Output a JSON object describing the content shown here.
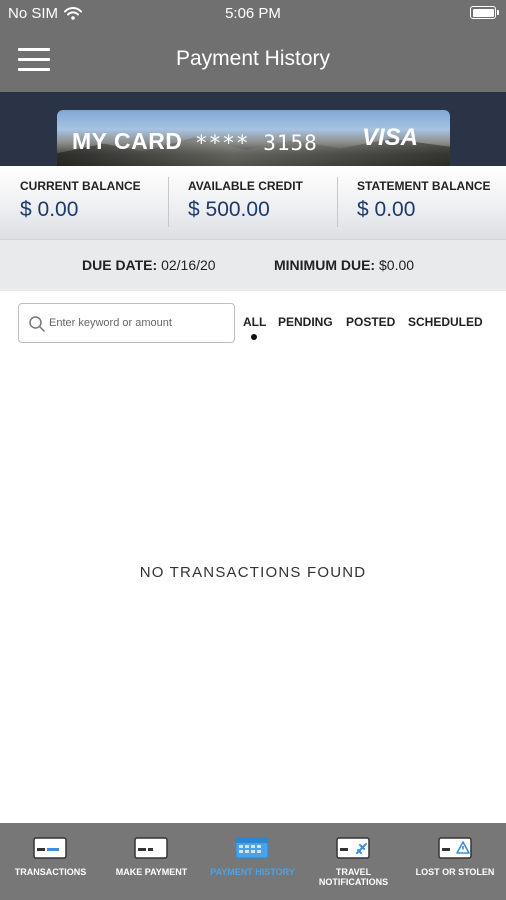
{
  "status_bar": {
    "carrier": "No SIM",
    "time": "5:06 PM"
  },
  "header": {
    "title": "Payment History"
  },
  "card": {
    "name": "MY CARD",
    "number_masked": "**** 3158",
    "brand": "VISA"
  },
  "balances": [
    {
      "label": "CURRENT BALANCE",
      "value": "$ 0.00"
    },
    {
      "label": "AVAILABLE CREDIT",
      "value": "$ 500.00"
    },
    {
      "label": "STATEMENT BALANCE",
      "value": "$ 0.00"
    }
  ],
  "due": {
    "due_date_label": "DUE DATE:",
    "due_date_value": "02/16/20",
    "minimum_due_label": "MINIMUM DUE:",
    "minimum_due_value": "$0.00"
  },
  "search": {
    "placeholder": "Enter keyword or amount",
    "value": ""
  },
  "filters": {
    "tabs": [
      "ALL",
      "PENDING",
      "POSTED",
      "SCHEDULED"
    ],
    "selected": "ALL"
  },
  "empty_state": {
    "message": "NO TRANSACTIONS FOUND"
  },
  "tab_bar": {
    "items": [
      {
        "label": "TRANSACTIONS",
        "icon": "card-icon"
      },
      {
        "label": "MAKE PAYMENT",
        "icon": "card-payment-icon"
      },
      {
        "label": "PAYMENT HISTORY",
        "icon": "calendar-icon",
        "active": true
      },
      {
        "label": "TRAVEL NOTIFICATIONS",
        "icon": "card-plane-icon"
      },
      {
        "label": "LOST OR STOLEN",
        "icon": "card-warning-icon"
      }
    ]
  },
  "colors": {
    "header_bg": "#707070",
    "card_band_bg": "#2b3347",
    "balance_value": "#1c3a6e",
    "tab_bar_bg": "#777777",
    "active_tab": "#4aa3e8"
  }
}
